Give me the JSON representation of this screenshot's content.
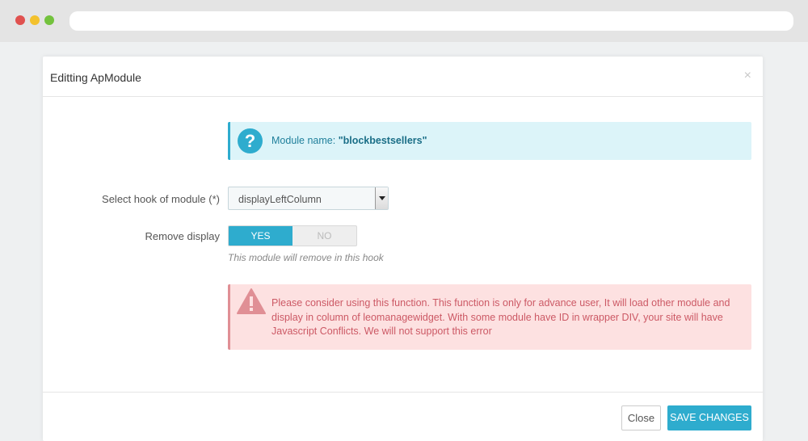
{
  "modal": {
    "title": "Editting ApModule",
    "close_symbol": "×"
  },
  "info_alert": {
    "icon": "question-icon",
    "icon_glyph": "?",
    "label": "Module name: ",
    "value": "\"blockbestsellers\""
  },
  "form": {
    "hook_label": "Select hook of module (*)",
    "hook_value": "displayLeftColumn",
    "remove_label": "Remove display",
    "remove_yes": "YES",
    "remove_no": "NO",
    "remove_selected": "YES",
    "remove_help": "This module will remove in this hook"
  },
  "warning_alert": {
    "icon": "warning-triangle-icon",
    "text": "Please consider using this function. This function is only for advance user, It will load other module and display in column of leomanagewidget. With some module have ID in wrapper DIV, your site will have Javascript Conflicts. We will not support this error"
  },
  "footer": {
    "close_label": "Close",
    "save_label": "SAVE CHANGES"
  },
  "colors": {
    "accent": "#2eacce",
    "info_bg": "#dcf4f9",
    "danger_bg": "#fde1e1",
    "danger_text": "#cc5965"
  }
}
